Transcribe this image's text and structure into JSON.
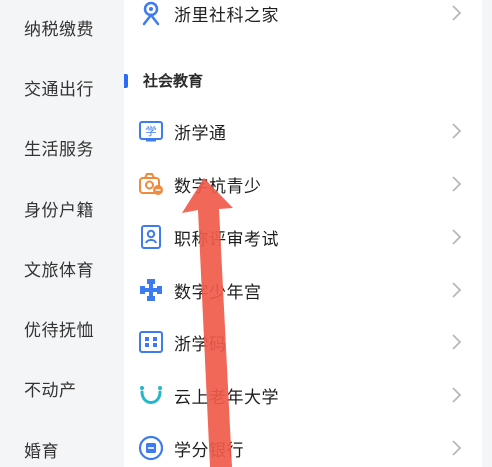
{
  "sidebar": {
    "items": [
      {
        "label": "纳税缴费"
      },
      {
        "label": "交通出行"
      },
      {
        "label": "生活服务"
      },
      {
        "label": "身份户籍"
      },
      {
        "label": "文旅体育"
      },
      {
        "label": "优待抚恤"
      },
      {
        "label": "不动产"
      },
      {
        "label": "婚育"
      }
    ]
  },
  "main": {
    "top_item": {
      "label": "浙里社科之家",
      "icon": "community-icon"
    },
    "section_title": "社会教育",
    "items": [
      {
        "label": "浙学通",
        "icon": "study-book-icon"
      },
      {
        "label": "数字杭青少",
        "icon": "youth-camera-icon"
      },
      {
        "label": "职称评审考试",
        "icon": "id-card-icon"
      },
      {
        "label": "数字少年宫",
        "icon": "puzzle-icon"
      },
      {
        "label": "浙学码",
        "icon": "qr-code-icon"
      },
      {
        "label": "云上老年大学",
        "icon": "smile-arc-icon"
      },
      {
        "label": "学分银行",
        "icon": "bank-badge-icon"
      }
    ]
  },
  "colors": {
    "accent": "#2a6cf6",
    "icon_blue": "#3d7bef",
    "icon_orange": "#f08a3c",
    "icon_teal": "#23b8c9",
    "arrow_red": "#f05a4a"
  }
}
